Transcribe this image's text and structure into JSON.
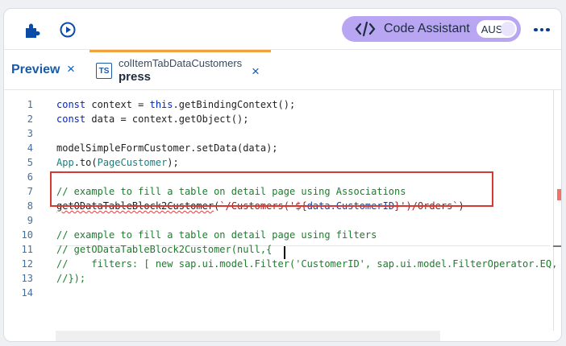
{
  "toolbar": {
    "code_assistant_label": "Code Assistant",
    "toggle_text": "AUS"
  },
  "tabs": {
    "preview_label": "Preview",
    "close_symbol": "×",
    "active_file": "colItemTabDataCustomers",
    "active_event": "press",
    "active_file_type": "TS"
  },
  "editor": {
    "line_numbers": [
      "1",
      "2",
      "3",
      "4",
      "5",
      "6",
      "7",
      "8",
      "9",
      "10",
      "11",
      "12",
      "13",
      "14"
    ],
    "lines": [
      "const context = this.getBindingContext();",
      "const data = context.getObject();",
      "",
      "modelSimpleFormCustomer.setData(data);",
      "App.to(PageCustomer);",
      "",
      "// example to fill a table on detail page using Associations",
      "getODataTableBlock2Customer(`/Customers('${data.CustomerID}')/Orders`)",
      "",
      "// example to fill a table on detail page using filters",
      "// getODataTableBlock2Customer(null,{",
      "//    filters: [ new sap.ui.model.Filter('CustomerID', sap.ui.model.FilterOperator.EQ,",
      "//});",
      ""
    ]
  },
  "colors": {
    "code_assistant_bg": "#b9a6f2",
    "active_tab_accent": "#f1a23c",
    "highlight_border": "#d43a33",
    "link_blue": "#1a5ba8"
  }
}
